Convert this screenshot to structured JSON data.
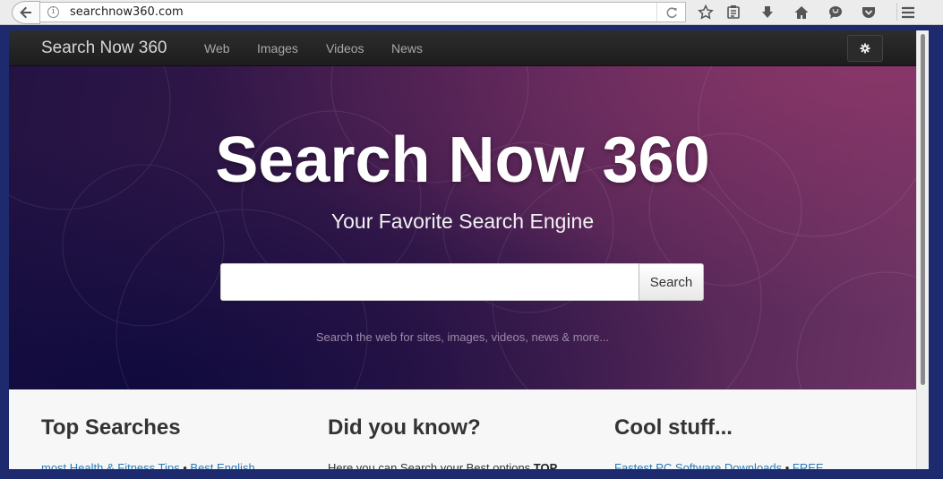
{
  "browser": {
    "url": "searchnow360.com"
  },
  "navbar": {
    "brand": "Search Now 360",
    "links": [
      "Web",
      "Images",
      "Videos",
      "News"
    ]
  },
  "hero": {
    "title": "Search Now 360",
    "subtitle": "Your Favorite Search Engine",
    "search_placeholder": "",
    "search_button": "Search",
    "hint": "Search the web for sites, images, videos, news & more..."
  },
  "sections": {
    "top_searches": {
      "title": "Top Searches",
      "link_1": "most Health & Fitness Tips",
      "sep": " • ",
      "link_2": "Best English"
    },
    "did_you_know": {
      "title": "Did you know?",
      "text": "Here you can Search your Best options ",
      "text_bold": "TOP"
    },
    "cool_stuff": {
      "title": "Cool stuff...",
      "link_1": "Fastest PC Software Downloads",
      "sep": " • ",
      "link_2": "FREE"
    }
  },
  "colors": {
    "hero_dark": "#231343",
    "hero_light": "#6b3464",
    "link": "#2a7ab8",
    "navbar": "#222222"
  }
}
